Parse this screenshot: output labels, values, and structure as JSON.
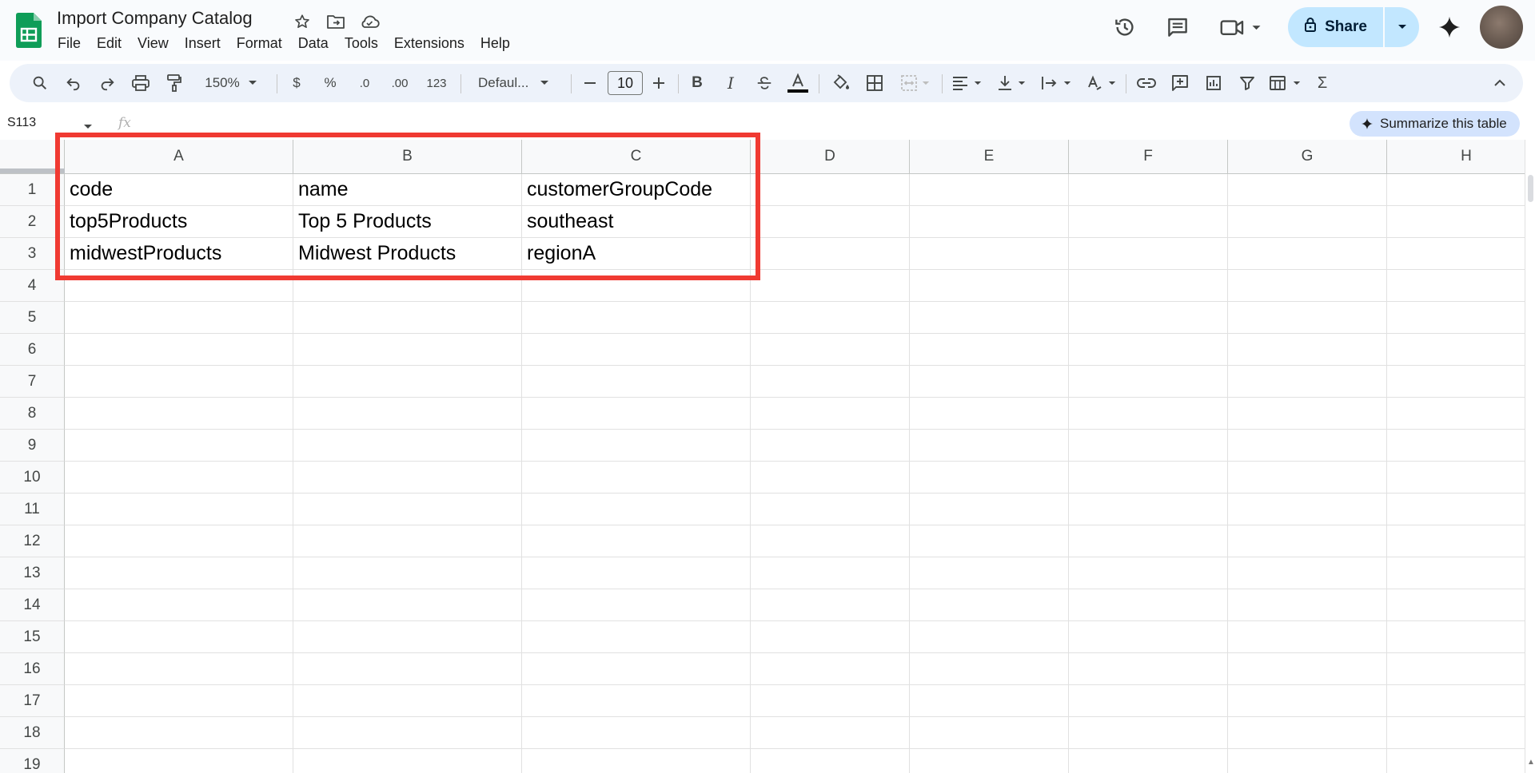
{
  "app": {
    "doc_title": "Import Company Catalog",
    "menu": [
      "File",
      "Edit",
      "View",
      "Insert",
      "Format",
      "Data",
      "Tools",
      "Extensions",
      "Help"
    ],
    "share_label": "Share",
    "icons": {
      "logo": "google-sheets-logo",
      "star": "star-icon",
      "move": "folder-move-icon",
      "cloud": "cloud-saved-icon",
      "history": "version-history-icon",
      "comments": "comments-icon",
      "meet": "meet-video-icon",
      "lock": "lock-icon",
      "gemini": "gemini-sparkle-icon"
    }
  },
  "toolbar": {
    "zoom": "150%",
    "currency": "$",
    "percent": "%",
    "decrease_decimal": ".0",
    "increase_decimal": ".00",
    "number_format": "123",
    "font_family": "Defaul...",
    "font_size": "10",
    "bold": "B",
    "italic": "I",
    "sum": "Σ"
  },
  "formula_bar": {
    "name_box": "S113",
    "fx": "fx",
    "summarize_label": "Summarize this table"
  },
  "sheet": {
    "columns": [
      "A",
      "B",
      "C",
      "D",
      "E",
      "F",
      "G",
      "H"
    ],
    "rows": [
      "1",
      "2",
      "3",
      "4",
      "5",
      "6",
      "7",
      "8",
      "9",
      "10",
      "11",
      "12",
      "13",
      "14",
      "15",
      "16",
      "17",
      "18",
      "19"
    ],
    "data": [
      [
        "code",
        "name",
        "customerGroupCode"
      ],
      [
        "top5Products",
        "Top 5 Products",
        "southeast"
      ],
      [
        "midwestProducts",
        "Midwest Products",
        "regionA"
      ]
    ]
  },
  "colors": {
    "accent": "#c2e7ff",
    "highlight_border": "#f03a32",
    "toolbar_bg": "#edf2fa",
    "sheets_green": "#0f9d58"
  }
}
